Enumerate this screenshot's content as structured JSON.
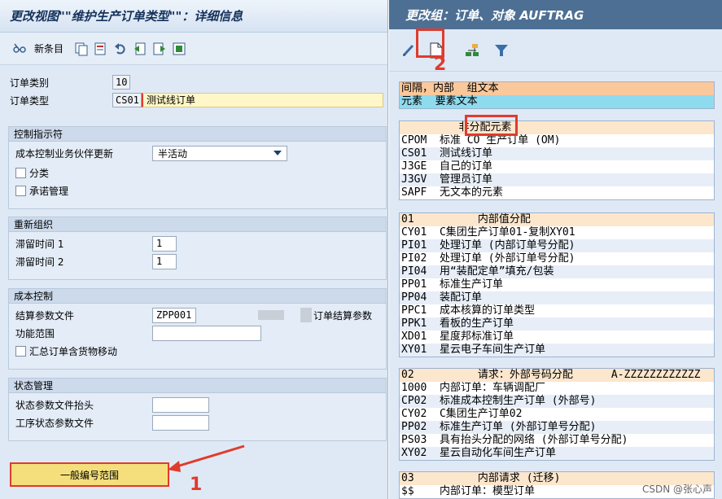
{
  "left": {
    "title": "更改视图\"\"维护生产订单类型\"\"：详细信息",
    "toolbar": {
      "new_entries": "新条目"
    },
    "order_category": {
      "label": "订单类别",
      "value": "10"
    },
    "order_type": {
      "label": "订单类型",
      "value": "CS01",
      "desc": "测试线订单"
    },
    "control_indicator": {
      "title": "控制指示符",
      "co_partner_update": {
        "label": "成本控制业务伙伴更新",
        "value": "半活动"
      },
      "classification": "分类",
      "commitment_mgmt": "承诺管理"
    },
    "reorganization": {
      "title": "重新组织",
      "residence_time1": {
        "label": "滞留时间 1",
        "value": "1"
      },
      "residence_time2": {
        "label": "滞留时间 2",
        "value": "1"
      }
    },
    "cost_control": {
      "title": "成本控制",
      "settlement_profile": {
        "label": "结算参数文件",
        "value": "ZPP001",
        "desc": "订单结算参数"
      },
      "functional_area": {
        "label": "功能范围",
        "value": ""
      },
      "collective_order": "汇总订单含货物移动"
    },
    "status_mgmt": {
      "title": "状态管理",
      "header_status": {
        "label": "状态参数文件抬头",
        "value": ""
      },
      "operation_status": {
        "label": "工序状态参数文件",
        "value": ""
      }
    },
    "number_range_button": "一般编号范围"
  },
  "right": {
    "title": "更改组：订单、对象 AUFTRAG",
    "block1": [
      {
        "text": "间隔，内部  组文本",
        "style": "hdr-orange"
      },
      {
        "text": "元素  要素文本",
        "style": "hdr-cyan"
      }
    ],
    "block2": [
      {
        "text": "         非分配元素",
        "style": "hdr-peach"
      },
      {
        "text": "CPOM  标准 CO 生产订单 (OM)",
        "style": ""
      },
      {
        "text": "CS01  测试线订单",
        "style": "stripe"
      },
      {
        "text": "J3GE  自己的订单",
        "style": ""
      },
      {
        "text": "J3GV  管理员订单",
        "style": "stripe"
      },
      {
        "text": "SAPF  无文本的元素",
        "style": ""
      }
    ],
    "block3": [
      {
        "text": "01          内部值分配",
        "style": "hdr-peach"
      },
      {
        "text": "CY01  C集团生产订单01-复制XY01",
        "style": ""
      },
      {
        "text": "PI01  处理订单 (内部订单号分配)",
        "style": "stripe"
      },
      {
        "text": "PI02  处理订单 (外部订单号分配)",
        "style": ""
      },
      {
        "text": "PI04  用“装配定单”填充/包装",
        "style": "stripe"
      },
      {
        "text": "PP01  标准生产订单",
        "style": ""
      },
      {
        "text": "PP04  装配订单",
        "style": "stripe"
      },
      {
        "text": "PPC1  成本核算的订单类型",
        "style": ""
      },
      {
        "text": "PPK1  看板的生产订单",
        "style": "stripe"
      },
      {
        "text": "XD01  星度邦标准订单",
        "style": ""
      },
      {
        "text": "XY01  星云电子车间生产订单",
        "style": "stripe"
      }
    ],
    "block4": [
      {
        "text": "02          请求：外部号码分配      A-ZZZZZZZZZZZZ",
        "style": "hdr-peach"
      },
      {
        "text": "1000  内部订单：车辆调配厂",
        "style": ""
      },
      {
        "text": "CP02  标准成本控制生产订单 (外部号)",
        "style": "stripe"
      },
      {
        "text": "CY02  C集团生产订单02",
        "style": ""
      },
      {
        "text": "PP02  标准生产订单 (外部订单号分配)",
        "style": "stripe"
      },
      {
        "text": "PS03  具有抬头分配的网络 (外部订单号分配)",
        "style": ""
      },
      {
        "text": "XY02  星云自动化车间生产订单",
        "style": "stripe"
      }
    ],
    "block5": [
      {
        "text": "03          内部请求 (迁移)",
        "style": "hdr-peach"
      },
      {
        "text": "$$    内部订单：模型订单",
        "style": ""
      }
    ]
  },
  "annotations": {
    "num1": "1",
    "num2": "2"
  },
  "watermark": "CSDN @张心声",
  "colors": {
    "annotation_red": "#e03b2c",
    "title_bar_blue": "#4d6f94",
    "button_yellow": "#f4df7c"
  }
}
